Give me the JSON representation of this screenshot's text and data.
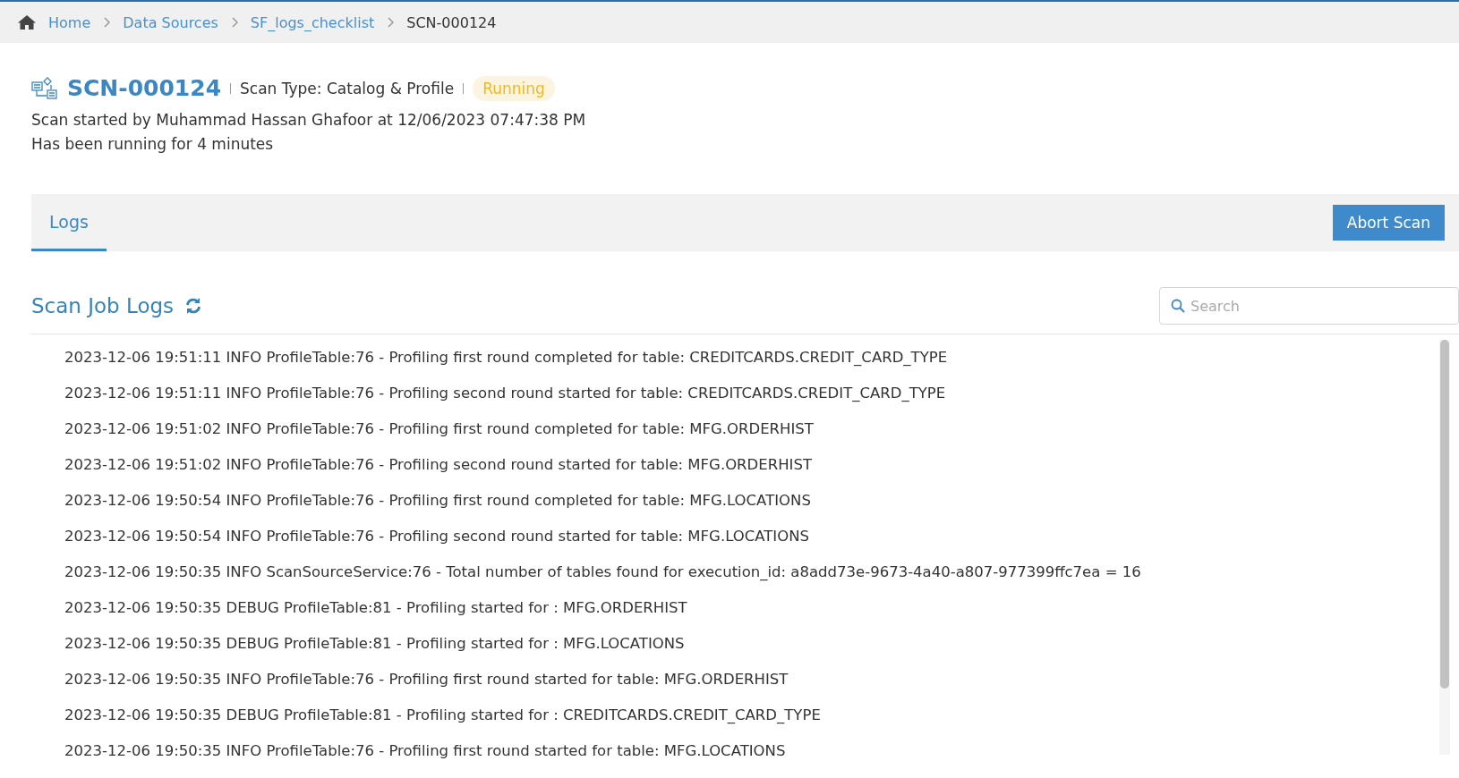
{
  "breadcrumb": [
    {
      "label": "Home",
      "link": true
    },
    {
      "label": "Data Sources",
      "link": true
    },
    {
      "label": "SF_logs_checklist",
      "link": true
    },
    {
      "label": "SCN-000124",
      "link": false
    }
  ],
  "header": {
    "title": "SCN-000124",
    "scan_type": "Scan Type: Catalog & Profile",
    "status": "Running",
    "started": "Scan started by Muhammad Hassan Ghafoor at 12/06/2023 07:47:38 PM",
    "duration": "Has been running for 4 minutes"
  },
  "tabs": [
    {
      "label": "Logs",
      "selected": true
    }
  ],
  "abort_button": "Abort Scan",
  "logs_title": "Scan Job Logs",
  "search": {
    "placeholder": "Search"
  },
  "logs": [
    "2023-12-06 19:51:11 INFO ProfileTable:76 - Profiling first round completed for table: CREDITCARDS.CREDIT_CARD_TYPE",
    "2023-12-06 19:51:11 INFO ProfileTable:76 - Profiling second round started for table: CREDITCARDS.CREDIT_CARD_TYPE",
    "2023-12-06 19:51:02 INFO ProfileTable:76 - Profiling first round completed for table: MFG.ORDERHIST",
    "2023-12-06 19:51:02 INFO ProfileTable:76 - Profiling second round started for table: MFG.ORDERHIST",
    "2023-12-06 19:50:54 INFO ProfileTable:76 - Profiling first round completed for table: MFG.LOCATIONS",
    "2023-12-06 19:50:54 INFO ProfileTable:76 - Profiling second round started for table: MFG.LOCATIONS",
    "2023-12-06 19:50:35 INFO ScanSourceService:76 - Total number of tables found for execution_id: a8add73e-9673-4a40-a807-977399ffc7ea = 16",
    "2023-12-06 19:50:35 DEBUG ProfileTable:81 - Profiling started for : MFG.ORDERHIST",
    "2023-12-06 19:50:35 DEBUG ProfileTable:81 - Profiling started for : MFG.LOCATIONS",
    "2023-12-06 19:50:35 INFO ProfileTable:76 - Profiling first round started for table: MFG.ORDERHIST",
    "2023-12-06 19:50:35 DEBUG ProfileTable:81 - Profiling started for : CREDITCARDS.CREDIT_CARD_TYPE",
    "2023-12-06 19:50:35 INFO ProfileTable:76 - Profiling first round started for table: MFG.LOCATIONS"
  ]
}
